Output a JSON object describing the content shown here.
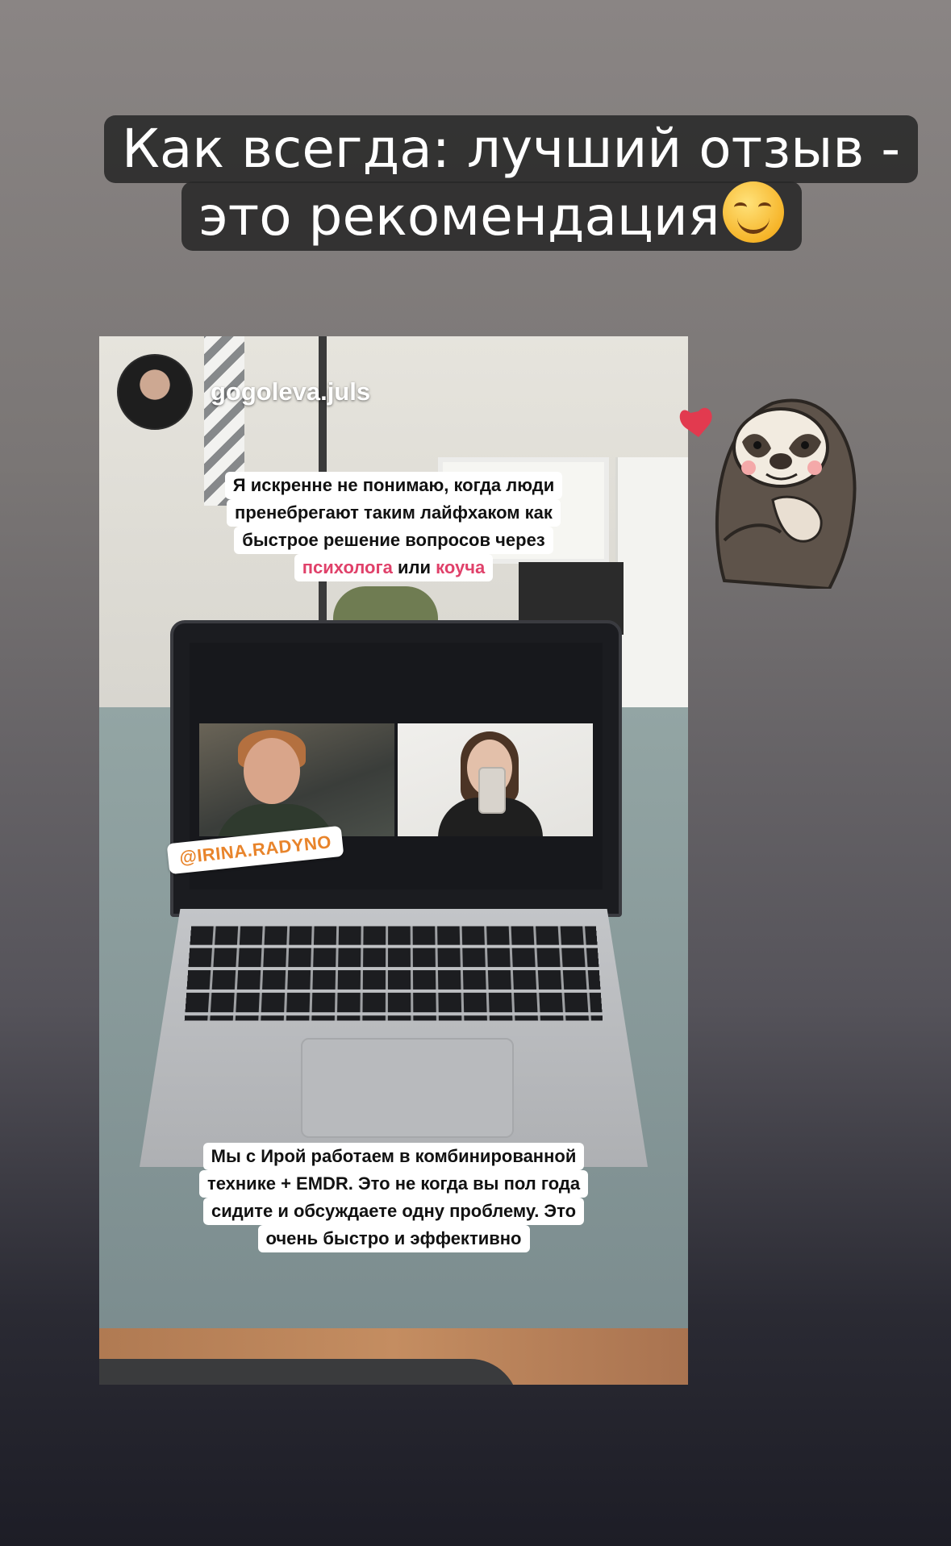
{
  "headline": {
    "line1": "Как всегда: лучший отзыв -",
    "line2": "это рекомендация"
  },
  "headline_emoji": "smiling-face-emoji",
  "story": {
    "username": "gogoleva.juls",
    "caption_top": {
      "row1": "Я искренне не понимаю, когда люди",
      "row2": "пренебрегают таким лайфхаком как",
      "row3": "быстрое решение вопросов через",
      "row4_a": "психолога",
      "row4_b": " или ",
      "row4_c": "коуча"
    },
    "mention": "@IRINA.RADYNO",
    "caption_bottom": {
      "row1": "Мы с Ирой работаем в комбинированной",
      "row2": "технике + EMDR. Это не когда вы пол года",
      "row3": "сидите и обсуждаете одну проблему. Это",
      "row4": "очень быстро и эффективно"
    }
  },
  "sticker": "sloth-with-heart-sticker",
  "colors": {
    "accent_pink": "#e0416a",
    "mention_orange": "#e8842b",
    "headline_bg": "#282828"
  }
}
